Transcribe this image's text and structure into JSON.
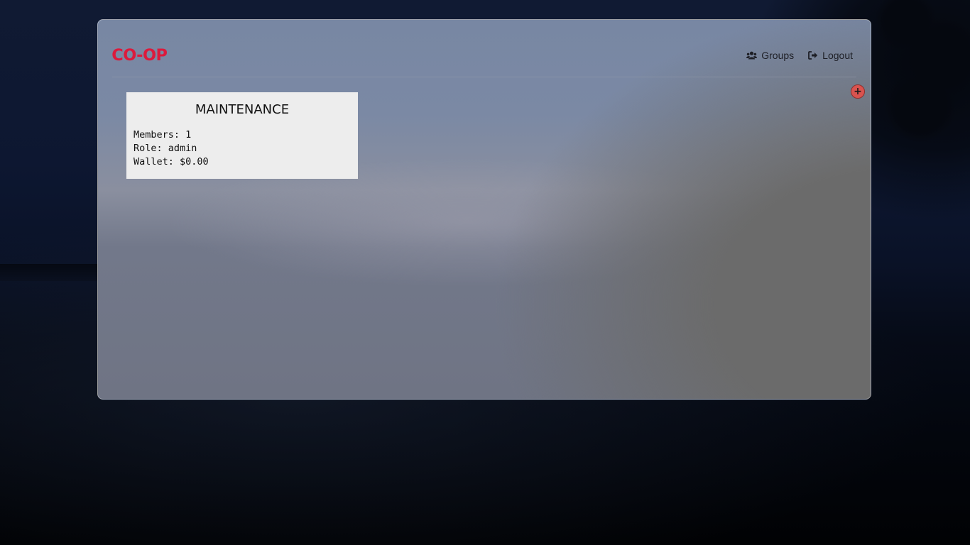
{
  "brand": {
    "logo_text": "CO-OP",
    "accent_color": "#dc1a3c"
  },
  "nav": {
    "groups": {
      "label": "Groups",
      "icon": "users-icon"
    },
    "logout": {
      "label": "Logout",
      "icon": "sign-out-icon"
    }
  },
  "actions": {
    "add_group": {
      "icon": "plus-icon",
      "symbol": "+",
      "color": "#d9534f"
    }
  },
  "groups": [
    {
      "name": "MAINTENANCE",
      "members_label": "Members: 1",
      "role_label": "Role: admin",
      "wallet_label": "Wallet: $0.00"
    }
  ]
}
